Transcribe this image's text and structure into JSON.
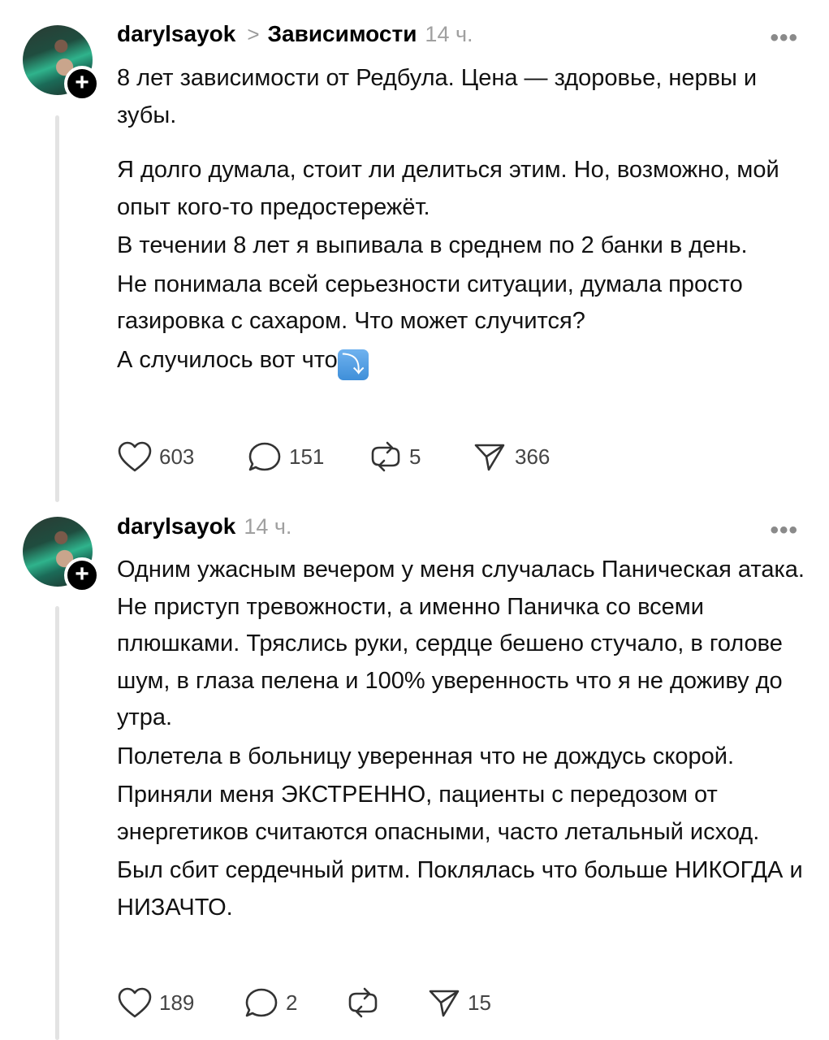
{
  "posts": [
    {
      "username": "darylsayok",
      "separator": ">",
      "topic": "Зависимости",
      "time": "14 ч.",
      "more": "•••",
      "plus": "+",
      "paragraphs": [
        "8 лет зависимости от Редбула. Цена — здоровье, нервы и зубы.",
        "Я долго думала, стоит ли делиться этим. Но, возможно, мой опыт кого-то предостережёт.",
        "В течении 8 лет я выпивала в среднем по 2 банки в день.",
        "Не понимала всей серьезности ситуации, думала просто газировка с сахаром. Что может случится?",
        "А случилось вот что"
      ],
      "emoji": "⤵",
      "likes": "603",
      "replies": "151",
      "reposts": "5",
      "shares": "366"
    },
    {
      "username": "darylsayok",
      "time": "14 ч.",
      "more": "•••",
      "plus": "+",
      "paragraphs": [
        "Одним ужасным вечером у меня случалась Паническая атака. Не приступ тревожности, а именно Паничка со всеми плюшками. Тряслись руки, сердце бешено стучало, в голове шум, в глаза пелена и 100% уверенность что я не доживу до утра.",
        "Полетела в больницу уверенная что не дождусь скорой.",
        "Приняли меня ЭКСТРЕННО, пациенты с передозом от энергетиков считаются опасными, часто летальный исход.",
        "Был сбит сердечный ритм. Поклялась что больше НИКОГДА и НИЗАЧТО."
      ],
      "likes": "189",
      "replies": "2",
      "reposts": "",
      "shares": "15"
    }
  ],
  "colors": {
    "text": "#111111",
    "muted": "#a0a0a0",
    "thread": "#e3e3e3",
    "emoji_blue": "#4a96dd"
  }
}
